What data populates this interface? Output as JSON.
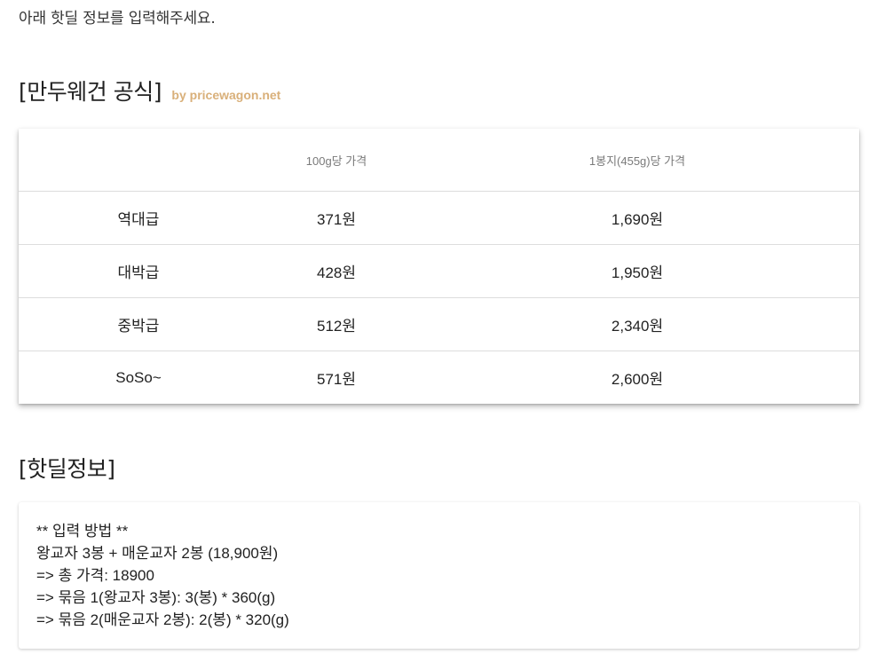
{
  "intro_text": "아래 핫딜 정보를 입력해주세요.",
  "official": {
    "title": "[만두웨건 공식]",
    "source": "by pricewagon.net",
    "columns": [
      "",
      "100g당 가격",
      "1봉지(455g)당 가격"
    ],
    "rows": [
      {
        "grade": "역대급",
        "per_100g": "371원",
        "per_bag": "1,690원"
      },
      {
        "grade": "대박급",
        "per_100g": "428원",
        "per_bag": "1,950원"
      },
      {
        "grade": "중박급",
        "per_100g": "512원",
        "per_bag": "2,340원"
      },
      {
        "grade": "SoSo~",
        "per_100g": "571원",
        "per_bag": "2,600원"
      }
    ]
  },
  "hotdeal": {
    "title": "[핫딜정보]",
    "lines": [
      "** 입력 방법 **",
      "왕교자 3봉 + 매운교자 2봉 (18,900원)",
      "=> 총 가격: 18900",
      "=> 묶음 1(왕교자 3봉): 3(봉) * 360(g)",
      "=> 묶음 2(매운교자 2봉): 2(봉) * 320(g)"
    ]
  },
  "colors": {
    "accent_link": "#d9b07a",
    "divider": "#dddddd"
  }
}
